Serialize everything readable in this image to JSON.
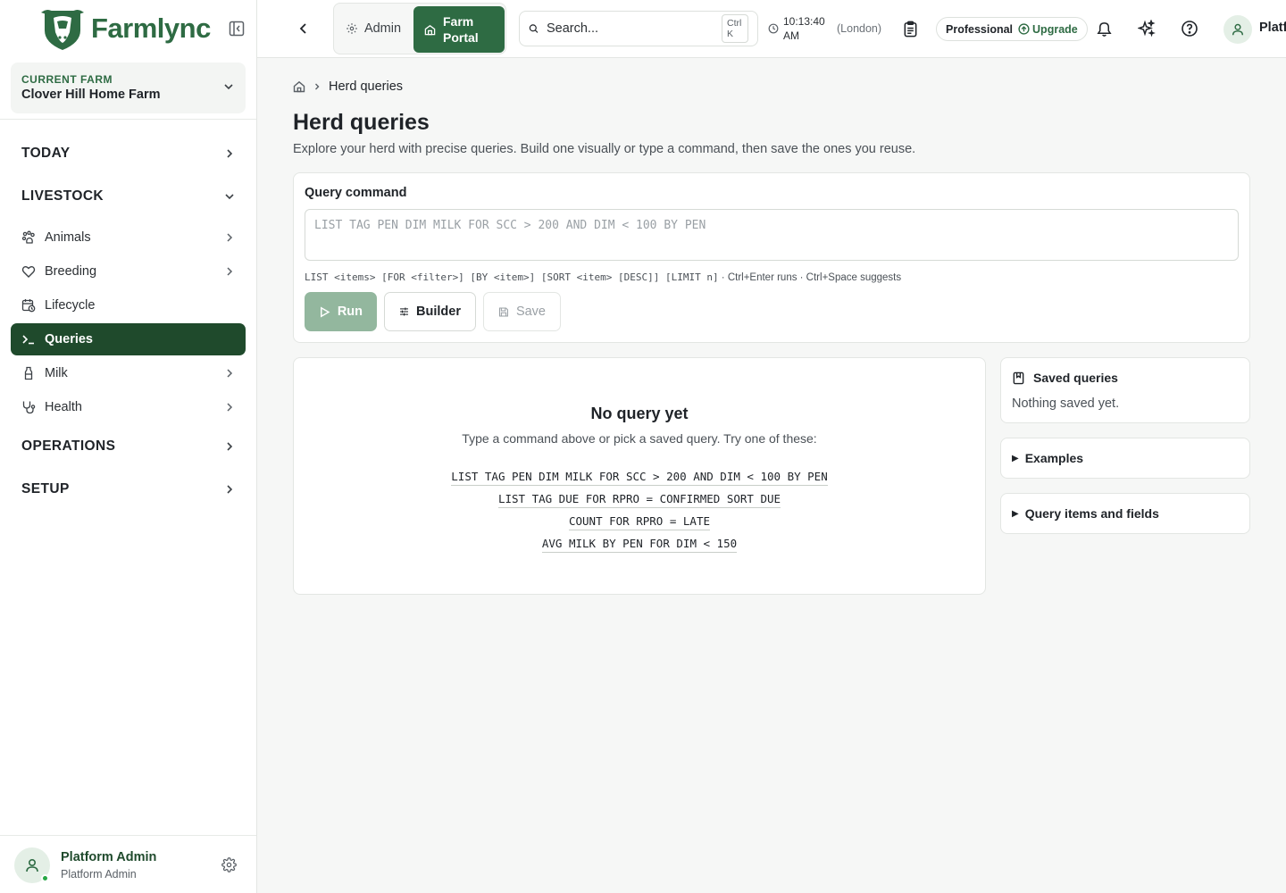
{
  "sidebar": {
    "brand": "Farmlync",
    "current_farm_caption": "CURRENT FARM",
    "current_farm": "Clover Hill Home Farm",
    "sections": [
      {
        "label": "TODAY"
      },
      {
        "label": "LIVESTOCK"
      },
      {
        "label": "OPERATIONS"
      },
      {
        "label": "SETUP"
      }
    ],
    "items": [
      {
        "label": "Animals"
      },
      {
        "label": "Breeding"
      },
      {
        "label": "Lifecycle"
      },
      {
        "label": "Queries"
      },
      {
        "label": "Milk"
      },
      {
        "label": "Health"
      }
    ],
    "user": {
      "name": "Platform Admin",
      "role": "Platform Admin"
    }
  },
  "topbar": {
    "admin_label": "Admin",
    "farm_portal_label": "Farm Portal",
    "search_placeholder": "Search...",
    "search_shortcut": "Ctrl K",
    "time": "10:13:40 AM",
    "timezone": "(London)",
    "plan": "Professional",
    "upgrade": "Upgrade",
    "user_name": "Platform Admin"
  },
  "page": {
    "breadcrumb_current": "Herd queries",
    "title": "Herd queries",
    "subtitle": "Explore your herd with precise queries. Build one visually or type a command, then save the ones you reuse."
  },
  "query": {
    "label": "Query command",
    "placeholder": "LIST TAG PEN DIM MILK FOR SCC > 200 AND DIM < 100 BY PEN",
    "syntax": "LIST <items> [FOR <filter>] [BY <item>] [SORT <item> [DESC]] [LIMIT n]",
    "shortcuts": " · Ctrl+Enter runs · Ctrl+Space suggests",
    "run": "Run",
    "builder": "Builder",
    "save": "Save"
  },
  "results": {
    "empty_title": "No query yet",
    "empty_sub": "Type a command above or pick a saved query. Try one of these:",
    "examples": [
      "LIST TAG PEN DIM MILK FOR SCC > 200 AND DIM < 100 BY PEN",
      "LIST TAG DUE FOR RPRO = CONFIRMED SORT DUE",
      "COUNT FOR RPRO = LATE",
      "AVG MILK BY PEN FOR DIM < 150"
    ]
  },
  "side_panel": {
    "saved_title": "Saved queries",
    "saved_empty": "Nothing saved yet.",
    "examples_title": "Examples",
    "fields_title": "Query items and fields"
  },
  "colors": {
    "brand_green": "#2e6b43",
    "active_nav": "#1f4a2c"
  }
}
